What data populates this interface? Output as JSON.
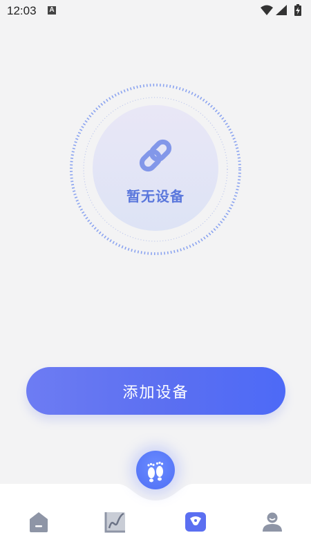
{
  "status_bar": {
    "time": "12:03",
    "notification_letter": "A",
    "icons": [
      "wifi-icon",
      "signal-icon",
      "battery-charging-icon"
    ]
  },
  "device_panel": {
    "icon": "link-icon",
    "empty_text": "暂无设备"
  },
  "add_device_button": {
    "label": "添加设备"
  },
  "tab_bar": {
    "center_icon": "footprints-icon",
    "tabs": [
      {
        "icon": "home-icon",
        "active": false
      },
      {
        "icon": "chart-icon",
        "active": false
      },
      {
        "icon": "device-icon",
        "active": true
      },
      {
        "icon": "profile-icon",
        "active": false
      }
    ]
  },
  "colors": {
    "accent": "#5b6ff1",
    "inactive_icon": "#8e95a6",
    "background": "#f3f3f4"
  }
}
